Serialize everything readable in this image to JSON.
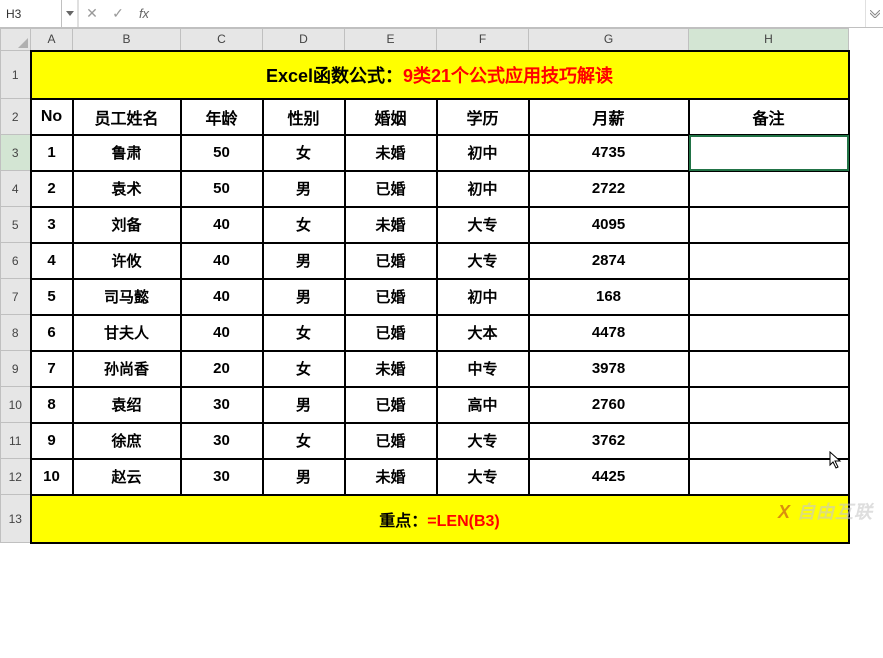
{
  "formula_bar": {
    "name_box": "H3",
    "cancel_symbol": "✕",
    "enter_symbol": "✓",
    "fx_label": "fx",
    "formula_value": ""
  },
  "columns": [
    "A",
    "B",
    "C",
    "D",
    "E",
    "F",
    "G",
    "H"
  ],
  "row_labels": [
    "1",
    "2",
    "3",
    "4",
    "5",
    "6",
    "7",
    "8",
    "9",
    "10",
    "11",
    "12",
    "13"
  ],
  "title": {
    "part1": "Excel函数公式：",
    "part2": "9类21个公式应用技巧解读"
  },
  "headers": [
    "No",
    "员工姓名",
    "年龄",
    "性别",
    "婚姻",
    "学历",
    "月薪",
    "备注"
  ],
  "rows": [
    {
      "no": "1",
      "name": "鲁肃",
      "age": "50",
      "gender": "女",
      "marital": "未婚",
      "edu": "初中",
      "salary": "4735",
      "remark": ""
    },
    {
      "no": "2",
      "name": "袁术",
      "age": "50",
      "gender": "男",
      "marital": "已婚",
      "edu": "初中",
      "salary": "2722",
      "remark": ""
    },
    {
      "no": "3",
      "name": "刘备",
      "age": "40",
      "gender": "女",
      "marital": "未婚",
      "edu": "大专",
      "salary": "4095",
      "remark": ""
    },
    {
      "no": "4",
      "name": "许攸",
      "age": "40",
      "gender": "男",
      "marital": "已婚",
      "edu": "大专",
      "salary": "2874",
      "remark": ""
    },
    {
      "no": "5",
      "name": "司马懿",
      "age": "40",
      "gender": "男",
      "marital": "已婚",
      "edu": "初中",
      "salary": "168",
      "remark": ""
    },
    {
      "no": "6",
      "name": "甘夫人",
      "age": "40",
      "gender": "女",
      "marital": "已婚",
      "edu": "大本",
      "salary": "4478",
      "remark": ""
    },
    {
      "no": "7",
      "name": "孙尚香",
      "age": "20",
      "gender": "女",
      "marital": "未婚",
      "edu": "中专",
      "salary": "3978",
      "remark": ""
    },
    {
      "no": "8",
      "name": "袁绍",
      "age": "30",
      "gender": "男",
      "marital": "已婚",
      "edu": "高中",
      "salary": "2760",
      "remark": ""
    },
    {
      "no": "9",
      "name": "徐庶",
      "age": "30",
      "gender": "女",
      "marital": "已婚",
      "edu": "大专",
      "salary": "3762",
      "remark": ""
    },
    {
      "no": "10",
      "name": "赵云",
      "age": "30",
      "gender": "男",
      "marital": "未婚",
      "edu": "大专",
      "salary": "4425",
      "remark": ""
    }
  ],
  "footer": {
    "label": "重点：",
    "formula": "=LEN(B3)"
  },
  "watermark": {
    "prefix": "X",
    "suffix": " 自由互联"
  },
  "selected_cell": "H3"
}
